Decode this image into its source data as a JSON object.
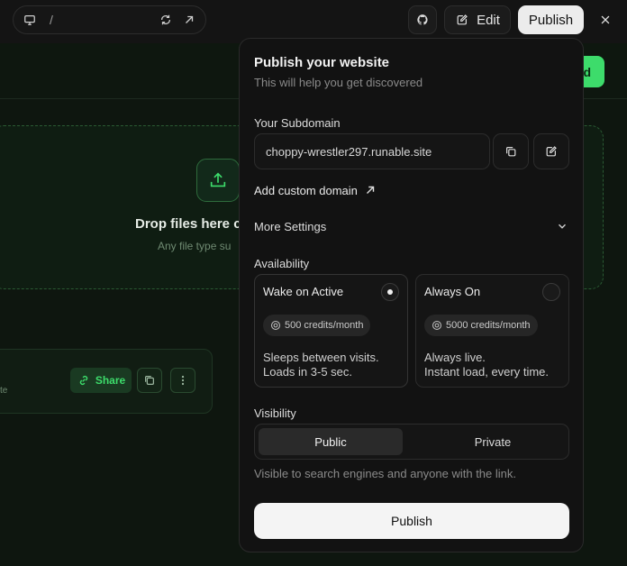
{
  "topbar": {
    "address_path": "/",
    "edit_label": "Edit",
    "publish_label": "Publish",
    "icons": [
      "monitor-icon",
      "refresh-icon",
      "external-link-icon",
      "github-icon",
      "edit-icon",
      "close-icon"
    ]
  },
  "background": {
    "header_button_label": "d",
    "drop_title": "Drop files here c",
    "drop_subtitle": "Any file type su",
    "card_text_fragment": "te",
    "share_label": "Share"
  },
  "panel": {
    "title": "Publish your website",
    "subtitle": "This will help you get discovered",
    "subdomain_label": "Your Subdomain",
    "subdomain_value": "choppy-wrestler297.runable.site",
    "custom_domain_label": "Add custom domain",
    "more_settings_label": "More Settings",
    "availability_label": "Availability",
    "options": [
      {
        "title": "Wake on Active",
        "credits": "500 credits/month",
        "desc_line1": "Sleeps between visits.",
        "desc_line2": "Loads in 3-5 sec.",
        "selected": true
      },
      {
        "title": "Always On",
        "credits": "5000 credits/month",
        "desc_line1": "Always live.",
        "desc_line2": "Instant load, every time.",
        "selected": false
      }
    ],
    "visibility_label": "Visibility",
    "visibility_options": [
      "Public",
      "Private"
    ],
    "visibility_selected": "Public",
    "visibility_note": "Visible to search engines and anyone with the link.",
    "publish_button_label": "Publish"
  },
  "colors": {
    "accent_green": "#3ddc6b",
    "panel_bg": "#121212",
    "page_bg": "#0e160f"
  }
}
